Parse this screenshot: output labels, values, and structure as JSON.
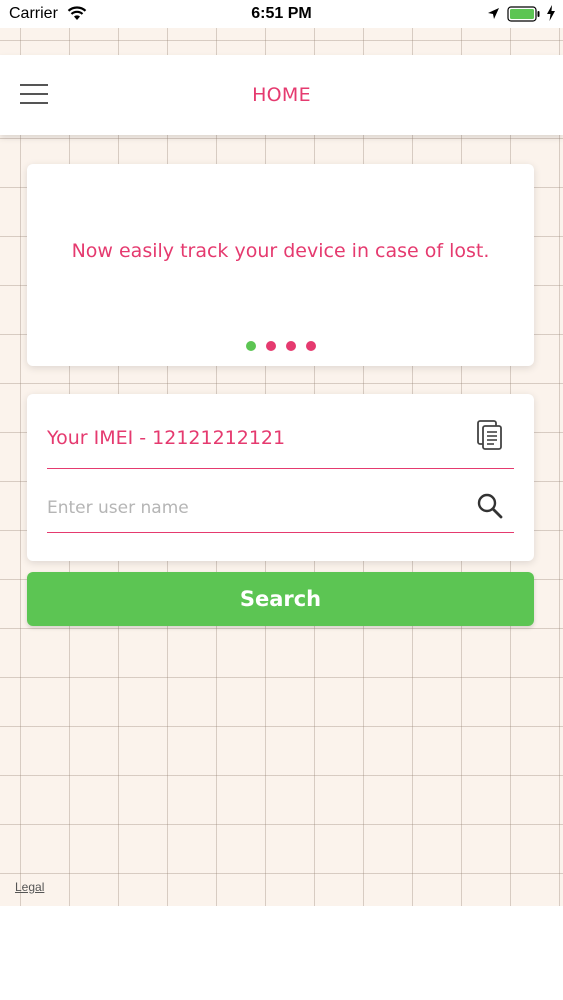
{
  "status_bar": {
    "carrier": "Carrier",
    "time": "6:51 PM",
    "icons": [
      "wifi-icon",
      "location-icon",
      "battery-icon",
      "charging-icon"
    ],
    "battery_color": "#5cc553"
  },
  "header": {
    "title": "HOME",
    "menu_icon": "hamburger-menu-icon"
  },
  "carousel": {
    "text": "Now easily track your device in case of lost.",
    "active_index": 0,
    "page_count": 4,
    "active_dot_color": "#5cc553",
    "inactive_dot_color": "#e53a6f"
  },
  "form": {
    "imei_text": "Your IMEI - 12121212121",
    "copy_icon": "copy-icon",
    "username_value": "",
    "username_placeholder": "Enter user name",
    "search_icon": "search-icon"
  },
  "search_button": {
    "label": "Search"
  },
  "footer": {
    "legal_label": "Legal"
  },
  "colors": {
    "accent": "#e53a6f",
    "button": "#5cc553",
    "background": "#fbf3ec"
  }
}
